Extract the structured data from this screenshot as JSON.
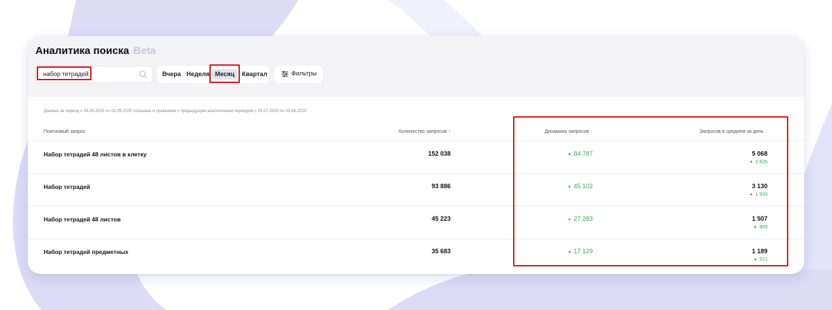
{
  "header": {
    "title": "Аналитика поиска",
    "badge": "Beta"
  },
  "search": {
    "value": "набор тетрадей"
  },
  "period": {
    "options": [
      "Вчера",
      "Неделя",
      "Месяц",
      "Квартал"
    ],
    "selected": "Месяц"
  },
  "filters": {
    "label": "Фильтры"
  },
  "note": "Данные за период с 04.08.2025 по 02.09.2025 показаны в сравнении с предыдущим аналогичным периодом с 05.07.2025 по 03.08.2025",
  "table": {
    "columns": {
      "query": "Поисковый запрос",
      "count": "Количество запросов",
      "dynamics": "Динамика запросов",
      "avg": "Запросов в среднем за день"
    },
    "rows": [
      {
        "query": "Набор тетрадей 48 листов в клетку",
        "count": "152 038",
        "dynamics": "84 787",
        "avg": "5 068",
        "avg_delta": "2 826"
      },
      {
        "query": "Набор тетрадей",
        "count": "93 886",
        "dynamics": "45 102",
        "avg": "3 130",
        "avg_delta": "1 503"
      },
      {
        "query": "Набор тетрадей 48 листов",
        "count": "45 223",
        "dynamics": "27 283",
        "avg": "1 507",
        "avg_delta": "909"
      },
      {
        "query": "Набор тетрадей предметных",
        "count": "35 683",
        "dynamics": "17 129",
        "avg": "1 189",
        "avg_delta": "571"
      }
    ]
  },
  "colors": {
    "accent_green": "#2faa5b",
    "sort_active": "#b44fd8",
    "highlight": "#e3141b",
    "background_shape": "#dcdcf7"
  }
}
